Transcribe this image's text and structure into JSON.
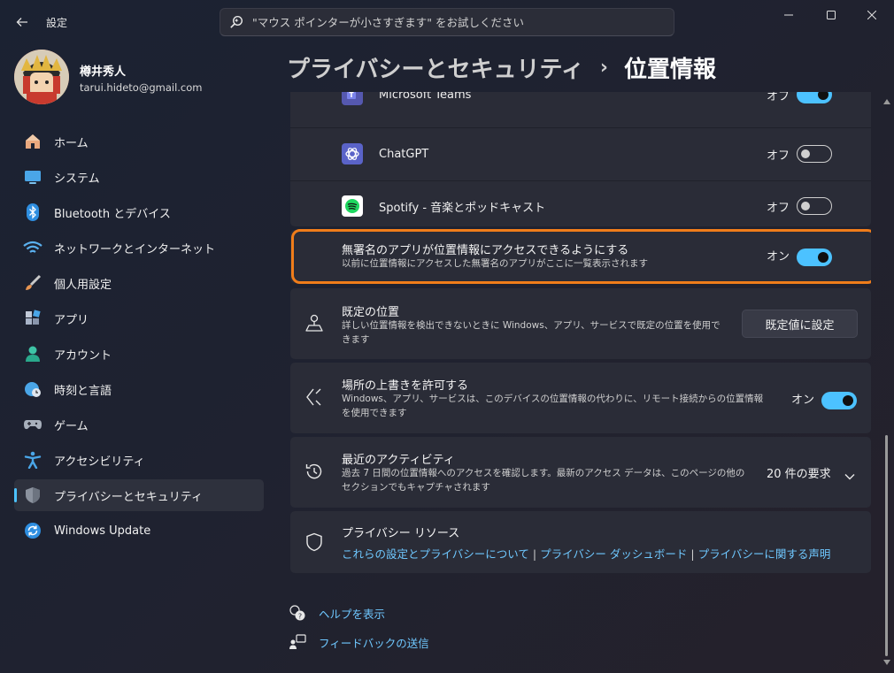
{
  "window": {
    "app_title": "設定",
    "search_placeholder": "\"マウス ポインターが小さすぎます\" をお試しください"
  },
  "profile": {
    "name": "樽井秀人",
    "email": "tarui.hideto@gmail.com"
  },
  "sidebar": {
    "items": [
      {
        "label": "ホーム",
        "icon": "home-icon"
      },
      {
        "label": "システム",
        "icon": "monitor-icon"
      },
      {
        "label": "Bluetooth とデバイス",
        "icon": "bluetooth-icon"
      },
      {
        "label": "ネットワークとインターネット",
        "icon": "wifi-icon"
      },
      {
        "label": "個人用設定",
        "icon": "brush-icon"
      },
      {
        "label": "アプリ",
        "icon": "apps-icon"
      },
      {
        "label": "アカウント",
        "icon": "person-icon"
      },
      {
        "label": "時刻と言語",
        "icon": "globe-clock-icon"
      },
      {
        "label": "ゲーム",
        "icon": "gamepad-icon"
      },
      {
        "label": "アクセシビリティ",
        "icon": "accessibility-icon"
      },
      {
        "label": "プライバシーとセキュリティ",
        "icon": "shield-icon",
        "active": true
      },
      {
        "label": "Windows Update",
        "icon": "update-icon"
      }
    ]
  },
  "breadcrumb": {
    "parent": "プライバシーとセキュリティ",
    "separator": "›",
    "current": "位置情報"
  },
  "apps": [
    {
      "name": "Microsoft Teams",
      "state": "オフ",
      "on": true,
      "icon": "teams-icon"
    },
    {
      "name": "ChatGPT",
      "state": "オフ",
      "on": false,
      "icon": "chatgpt-icon"
    },
    {
      "name": "Spotify - 音楽とポッドキャスト",
      "state": "オフ",
      "on": false,
      "icon": "spotify-icon"
    }
  ],
  "unnamed_apps": {
    "title": "無署名のアプリが位置情報にアクセスできるようにする",
    "description": "以前に位置情報にアクセスした無署名のアプリがここに一覧表示されます",
    "state": "オン",
    "on": true
  },
  "default_location": {
    "title": "既定の位置",
    "description": "詳しい位置情報を検出できないときに Windows、アプリ、サービスで既定の位置を使用できます",
    "button": "既定値に設定",
    "icon": "map-pin-icon"
  },
  "location_override": {
    "title": "場所の上書きを許可する",
    "description": "Windows、アプリ、サービスは、このデバイスの位置情報の代わりに、リモート接続からの位置情報を使用できます",
    "state": "オン",
    "on": true,
    "icon": "remote-arrows-icon"
  },
  "recent_activity": {
    "title": "最近のアクティビティ",
    "description": "過去 7 日間の位置情報へのアクセスを確認します。最新のアクセス データは、このページの他のセクションでもキャプチャされます",
    "count": "20 件の要求",
    "icon": "history-icon"
  },
  "privacy_resources": {
    "title": "プライバシー リソース",
    "links": [
      "これらの設定とプライバシーについて",
      "プライバシー ダッシュボード",
      "プライバシーに関する声明"
    ],
    "separator": "|",
    "icon": "shield-outline-icon"
  },
  "footer": {
    "help": "ヘルプを表示",
    "feedback": "フィードバックの送信"
  },
  "colors": {
    "accent": "#4cc2ff",
    "highlight_border": "#f07d1a",
    "card": "#2a2c37"
  }
}
